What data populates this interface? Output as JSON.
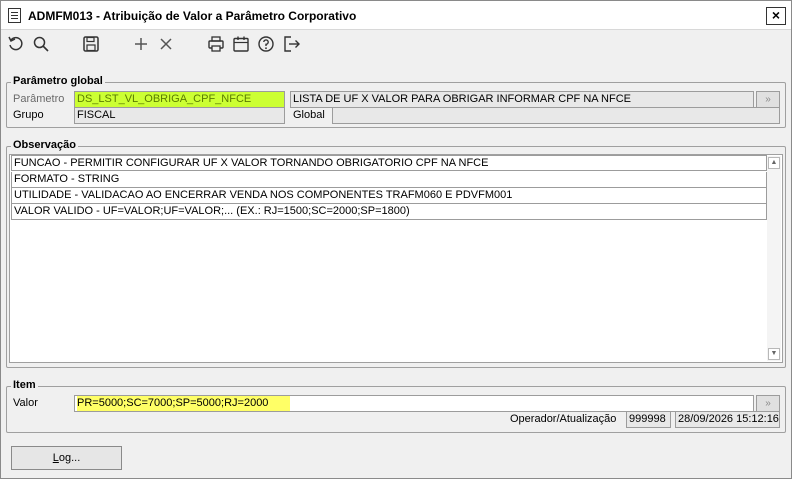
{
  "window": {
    "title": "ADMFM013 - Atribuição de Valor a Parâmetro Corporativo",
    "close_label": "×"
  },
  "toolbar": {
    "icons": [
      "undo-icon",
      "search-icon",
      "save-icon",
      "add-icon",
      "delete-icon",
      "print-icon",
      "calendar-icon",
      "help-icon",
      "exit-icon"
    ]
  },
  "parametro_global": {
    "title": "Parâmetro global",
    "parametro_label": "Parâmetro",
    "parametro_value": "DS_LST_VL_OBRIGA_CPF_NFCE",
    "parametro_desc": "LISTA DE UF X VALOR PARA OBRIGAR INFORMAR CPF NA NFCE",
    "grupo_label": "Grupo",
    "grupo_value": "FISCAL",
    "global_label": "Global",
    "global_value": "",
    "lookup_glyph": "»"
  },
  "observacao": {
    "title": "Observação",
    "lines": [
      "FUNCAO - PERMITIR CONFIGURAR UF X VALOR TORNANDO OBRIGATORIO CPF NA NFCE",
      "FORMATO - STRING",
      "UTILIDADE - VALIDACAO AO ENCERRAR VENDA NOS COMPONENTES TRAFM060 E PDVFM001",
      "VALOR VALIDO - UF=VALOR;UF=VALOR;... (EX.: RJ=1500;SC=2000;SP=1800)"
    ],
    "scroll_up": "▲",
    "scroll_down": "▼"
  },
  "item": {
    "title": "Item",
    "valor_label": "Valor",
    "valor_value": "PR=5000;SC=7000;SP=5000;RJ=2000",
    "operador_label": "Operador/Atualização",
    "operador_value": "999998",
    "atualizacao_value": "28/09/2026 15:12:16",
    "lookup_glyph": "»"
  },
  "footer": {
    "log_label_u": "L",
    "log_label_rest": "og..."
  }
}
